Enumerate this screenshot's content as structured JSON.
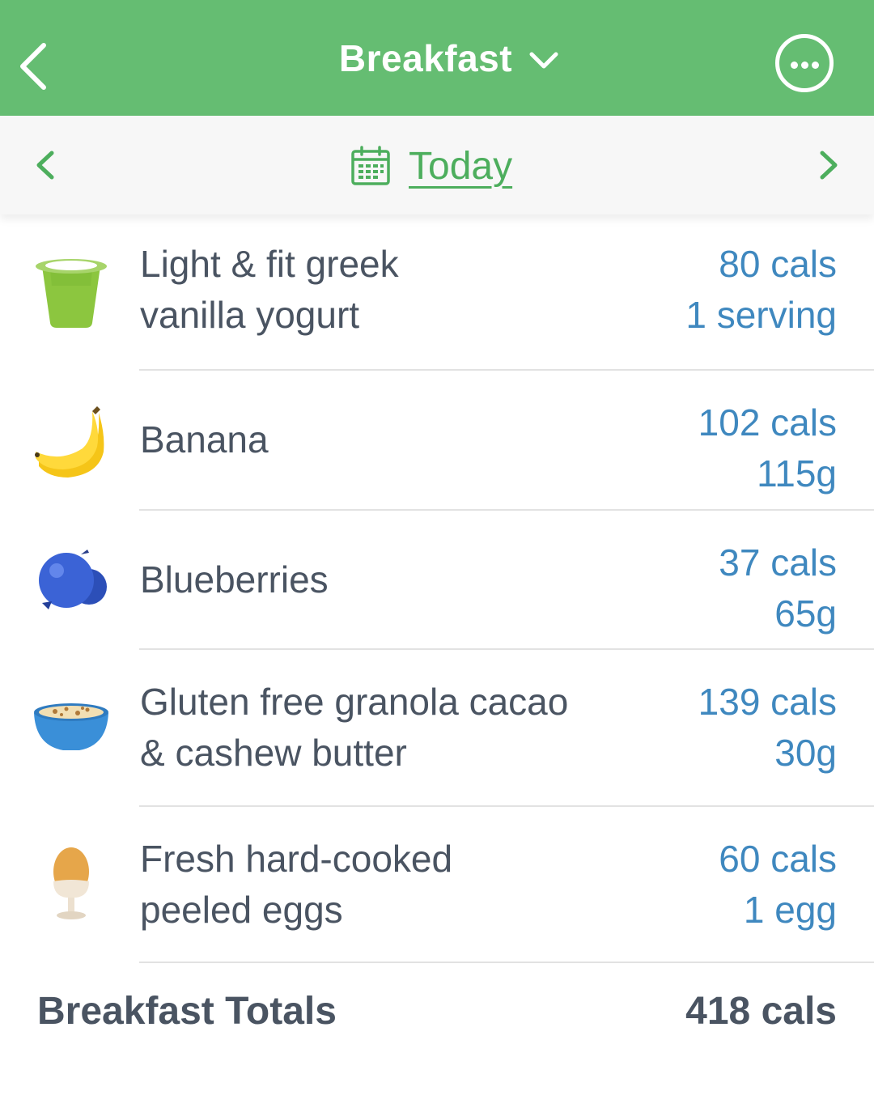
{
  "header": {
    "title": "Breakfast",
    "accent": "#65bd72"
  },
  "datebar": {
    "label": "Today",
    "accent": "#4dae5d"
  },
  "entries": [
    {
      "name_line1": "Light & fit greek",
      "name_line2": "vanilla yogurt",
      "cals": "80 cals",
      "amount": "1 serving",
      "icon": "yogurt-cup-icon"
    },
    {
      "name_line1": "Banana",
      "name_line2": "",
      "cals": "102 cals",
      "amount": "115g",
      "icon": "banana-icon"
    },
    {
      "name_line1": "Blueberries",
      "name_line2": "",
      "cals": "37 cals",
      "amount": "65g",
      "icon": "blueberries-icon"
    },
    {
      "name_line1": "Gluten free granola cacao",
      "name_line2": "& cashew butter",
      "cals": "139 cals",
      "amount": "30g",
      "icon": "cereal-bowl-icon"
    },
    {
      "name_line1": "Fresh hard-cooked",
      "name_line2": "peeled eggs",
      "cals": "60 cals",
      "amount": "1 egg",
      "icon": "egg-cup-icon"
    }
  ],
  "totals": {
    "label": "Breakfast Totals",
    "value": "418 cals"
  },
  "colors": {
    "value_blue": "#3f88bf",
    "text_dark": "#4a5462"
  }
}
